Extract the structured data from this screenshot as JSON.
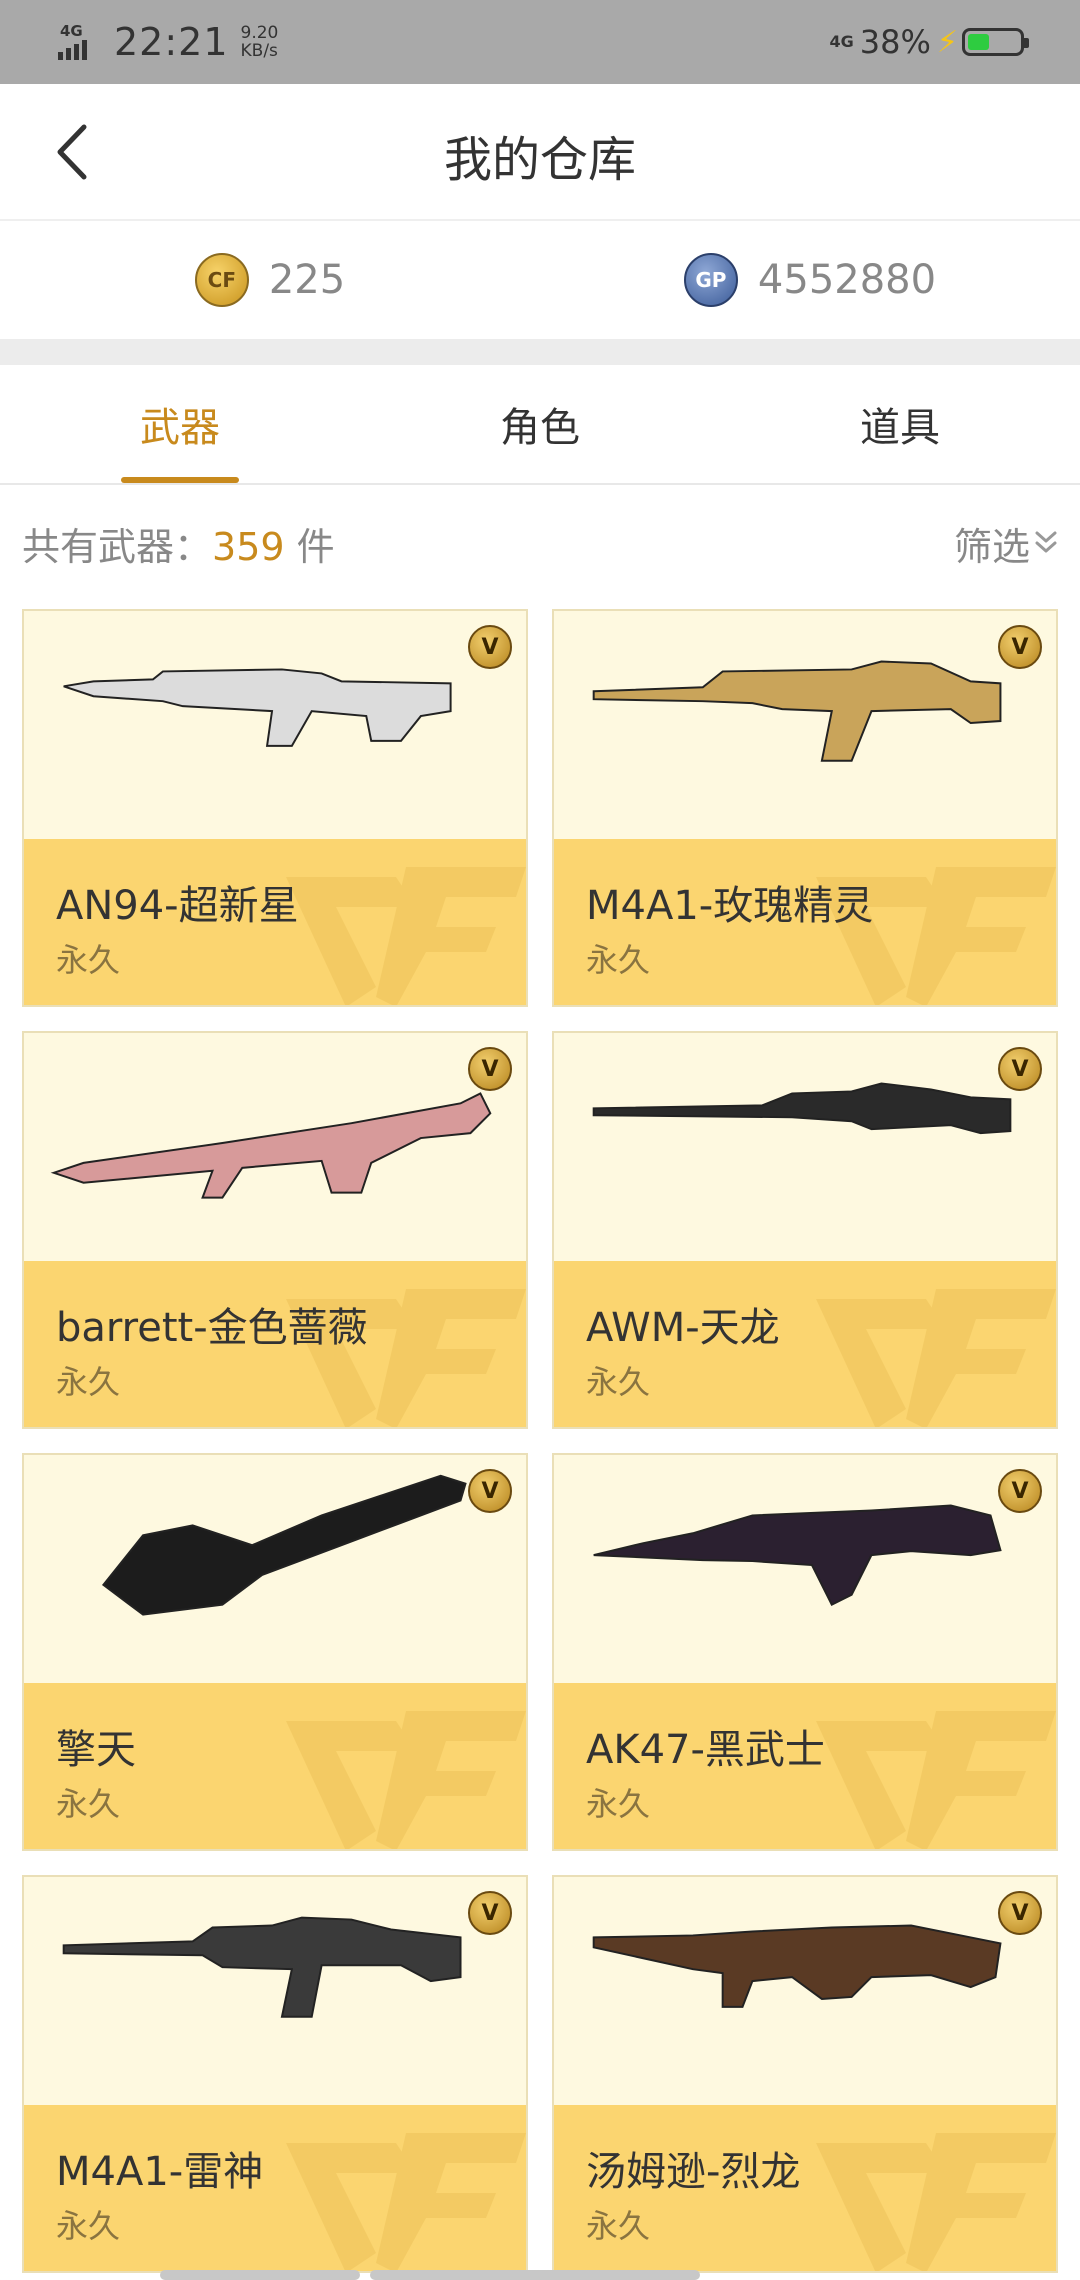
{
  "status_bar": {
    "network": "4G",
    "time": "22:21",
    "speed_value": "9.20",
    "speed_unit": "KB/s",
    "network_right": "4G",
    "battery": "38%"
  },
  "header": {
    "title": "我的仓库"
  },
  "currency": [
    {
      "icon": "cf-coin-icon",
      "symbol": "CF",
      "value": "225"
    },
    {
      "icon": "gp-coin-icon",
      "symbol": "GP",
      "value": "4552880"
    }
  ],
  "tabs": [
    {
      "label": "武器",
      "active": true
    },
    {
      "label": "角色",
      "active": false
    },
    {
      "label": "道具",
      "active": false
    }
  ],
  "summary": {
    "prefix": "共有武器：",
    "count": "359",
    "suffix": " 件"
  },
  "filter": {
    "label": "筛选"
  },
  "vip_badge": "V",
  "weapons": [
    {
      "name": "AN94-超新星",
      "term": "永久",
      "palette": "#dcdcdc"
    },
    {
      "name": "M4A1-玫瑰精灵",
      "term": "永久",
      "palette": "#c9a45a"
    },
    {
      "name": "barrett-金色蔷薇",
      "term": "永久",
      "palette": "#d79a9a"
    },
    {
      "name": "AWM-天龙",
      "term": "永久",
      "palette": "#2a2a2a"
    },
    {
      "name": "擎天",
      "term": "永久",
      "palette": "#1c1c1c"
    },
    {
      "name": "AK47-黑武士",
      "term": "永久",
      "palette": "#2b2030"
    },
    {
      "name": "M4A1-雷神",
      "term": "永久",
      "palette": "#3a3a3a"
    },
    {
      "name": "汤姆逊-烈龙",
      "term": "永久",
      "palette": "#5a3a24"
    }
  ],
  "colors": {
    "accent": "#c88a1d",
    "card_bottom": "#fbd570",
    "card_top": "#fef9e0",
    "status_bar": "#a9a9a9"
  }
}
